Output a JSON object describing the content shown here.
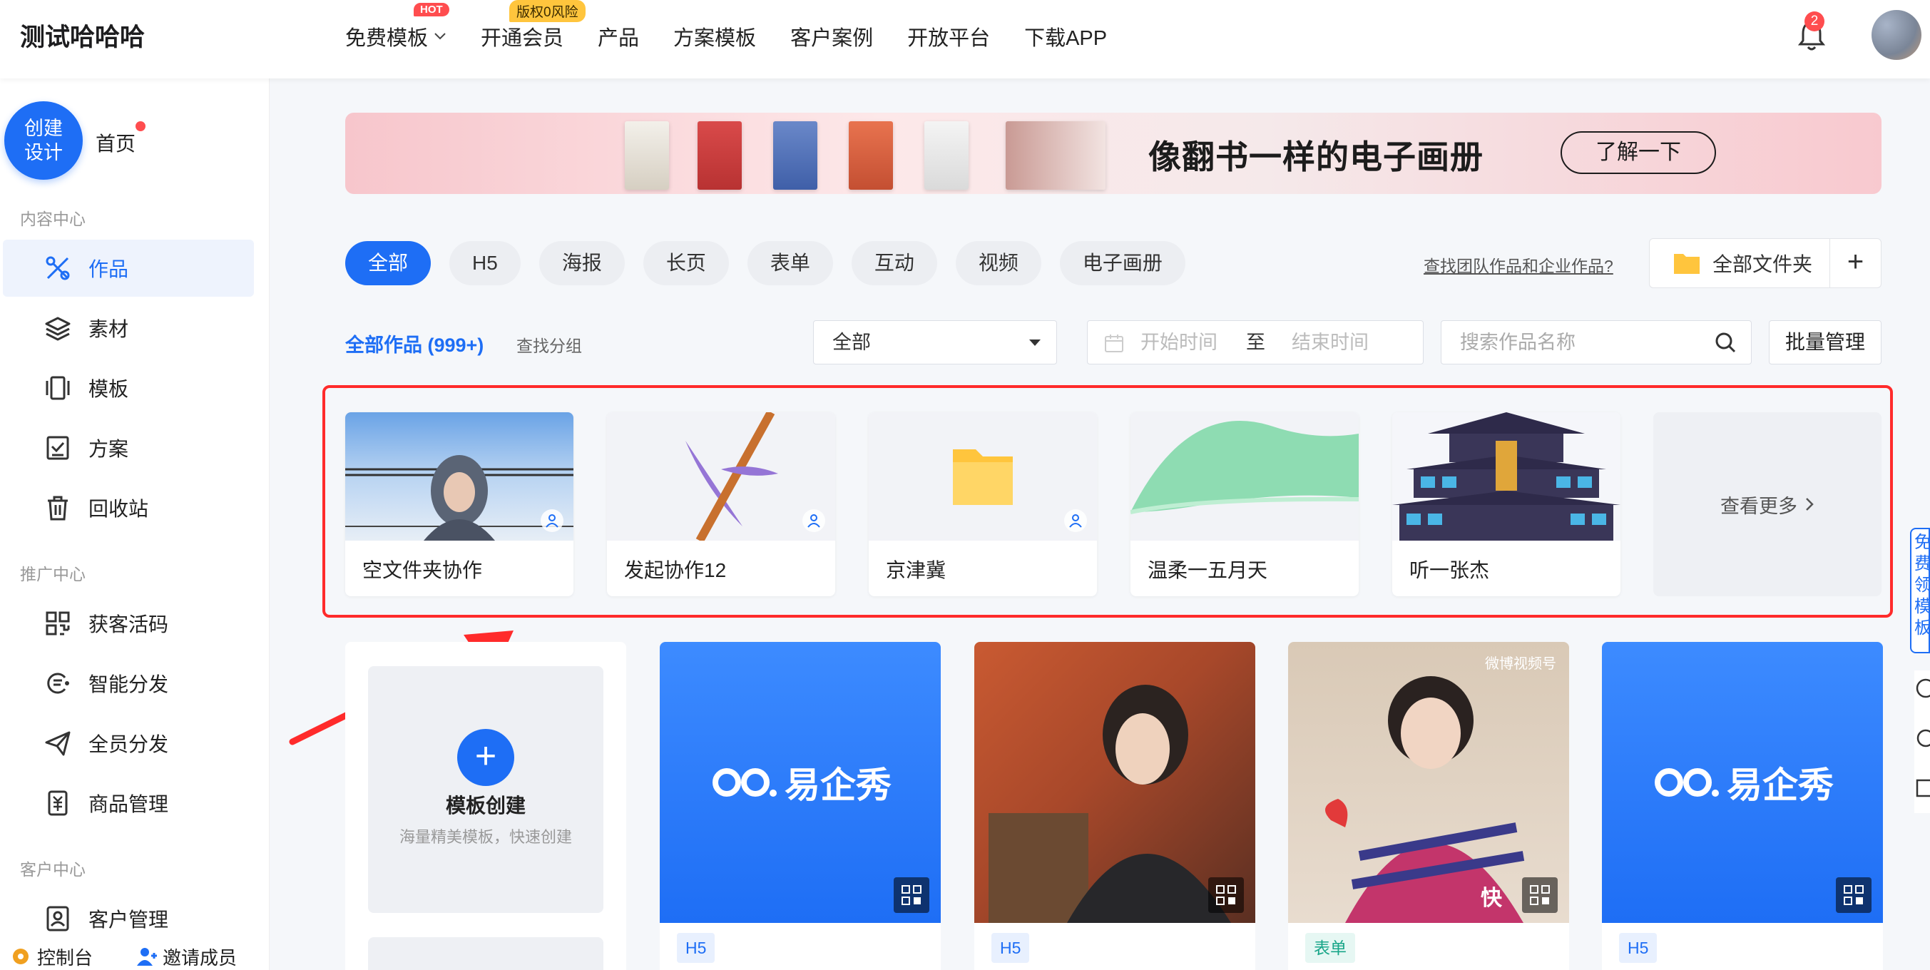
{
  "header": {
    "brand": "测试哈哈哈",
    "nav": [
      {
        "label": "免费模板"
      },
      {
        "label": "开通会员"
      },
      {
        "label": "产品"
      },
      {
        "label": "方案模板"
      },
      {
        "label": "客户案例"
      },
      {
        "label": "开放平台"
      },
      {
        "label": "下载APP"
      }
    ],
    "hot_badge": "HOT",
    "risk_badge": "版权0风险",
    "notification_count": "2"
  },
  "sidebar": {
    "create_line1": "创建",
    "create_line2": "设计",
    "home": "首页",
    "sections": [
      "内容中心",
      "推广中心",
      "客户中心"
    ],
    "items": [
      {
        "label": "作品",
        "icon": "scissors-icon"
      },
      {
        "label": "素材",
        "icon": "layers-icon"
      },
      {
        "label": "模板",
        "icon": "template-icon"
      },
      {
        "label": "方案",
        "icon": "checklist-icon"
      },
      {
        "label": "回收站",
        "icon": "trash-icon"
      },
      {
        "label": "获客活码",
        "icon": "qrcode-icon"
      },
      {
        "label": "智能分发",
        "icon": "smart-share-icon"
      },
      {
        "label": "全员分发",
        "icon": "send-icon"
      },
      {
        "label": "商品管理",
        "icon": "product-icon"
      },
      {
        "label": "客户管理",
        "icon": "customer-icon"
      }
    ],
    "footer": {
      "console": "控制台",
      "invite": "邀请成员"
    }
  },
  "banner": {
    "title": "像翻书一样的电子画册",
    "button": "了解一下"
  },
  "filters": {
    "tabs": [
      "全部",
      "H5",
      "海报",
      "长页",
      "表单",
      "互动",
      "视频",
      "电子画册"
    ],
    "active_tab": "全部",
    "team_link": "查找团队作品和企业作品?",
    "folder_button": "全部文件夹"
  },
  "works_bar": {
    "title": "全部作品 (999+)",
    "find_group": "查找分组",
    "select_value": "全部",
    "date_start_placeholder": "开始时间",
    "date_to": "至",
    "date_end_placeholder": "结束时间",
    "search_placeholder": "搜索作品名称",
    "batch_button": "批量管理"
  },
  "collab_folders": {
    "items": [
      {
        "name": "空文件夹协作"
      },
      {
        "name": "发起协作12"
      },
      {
        "name": "京津冀"
      },
      {
        "name": "温柔一五月天"
      },
      {
        "name": "听一张杰"
      }
    ],
    "see_more": "查看更多"
  },
  "template_card": {
    "plus": "+",
    "title": "模板创建",
    "subtitle": "海量精美模板，快速创建"
  },
  "works": [
    {
      "tag": "H5",
      "brand": "易企秀"
    },
    {
      "tag": "H5"
    },
    {
      "tag": "表单",
      "watermark": "微博视频号",
      "watermark2": "快"
    },
    {
      "tag": "H5",
      "brand": "易企秀"
    }
  ],
  "right_float": "免费领模板",
  "colors": {
    "accent": "#1e6ef5",
    "highlight": "#ff2b2b",
    "badge": "#ff4d4f"
  }
}
